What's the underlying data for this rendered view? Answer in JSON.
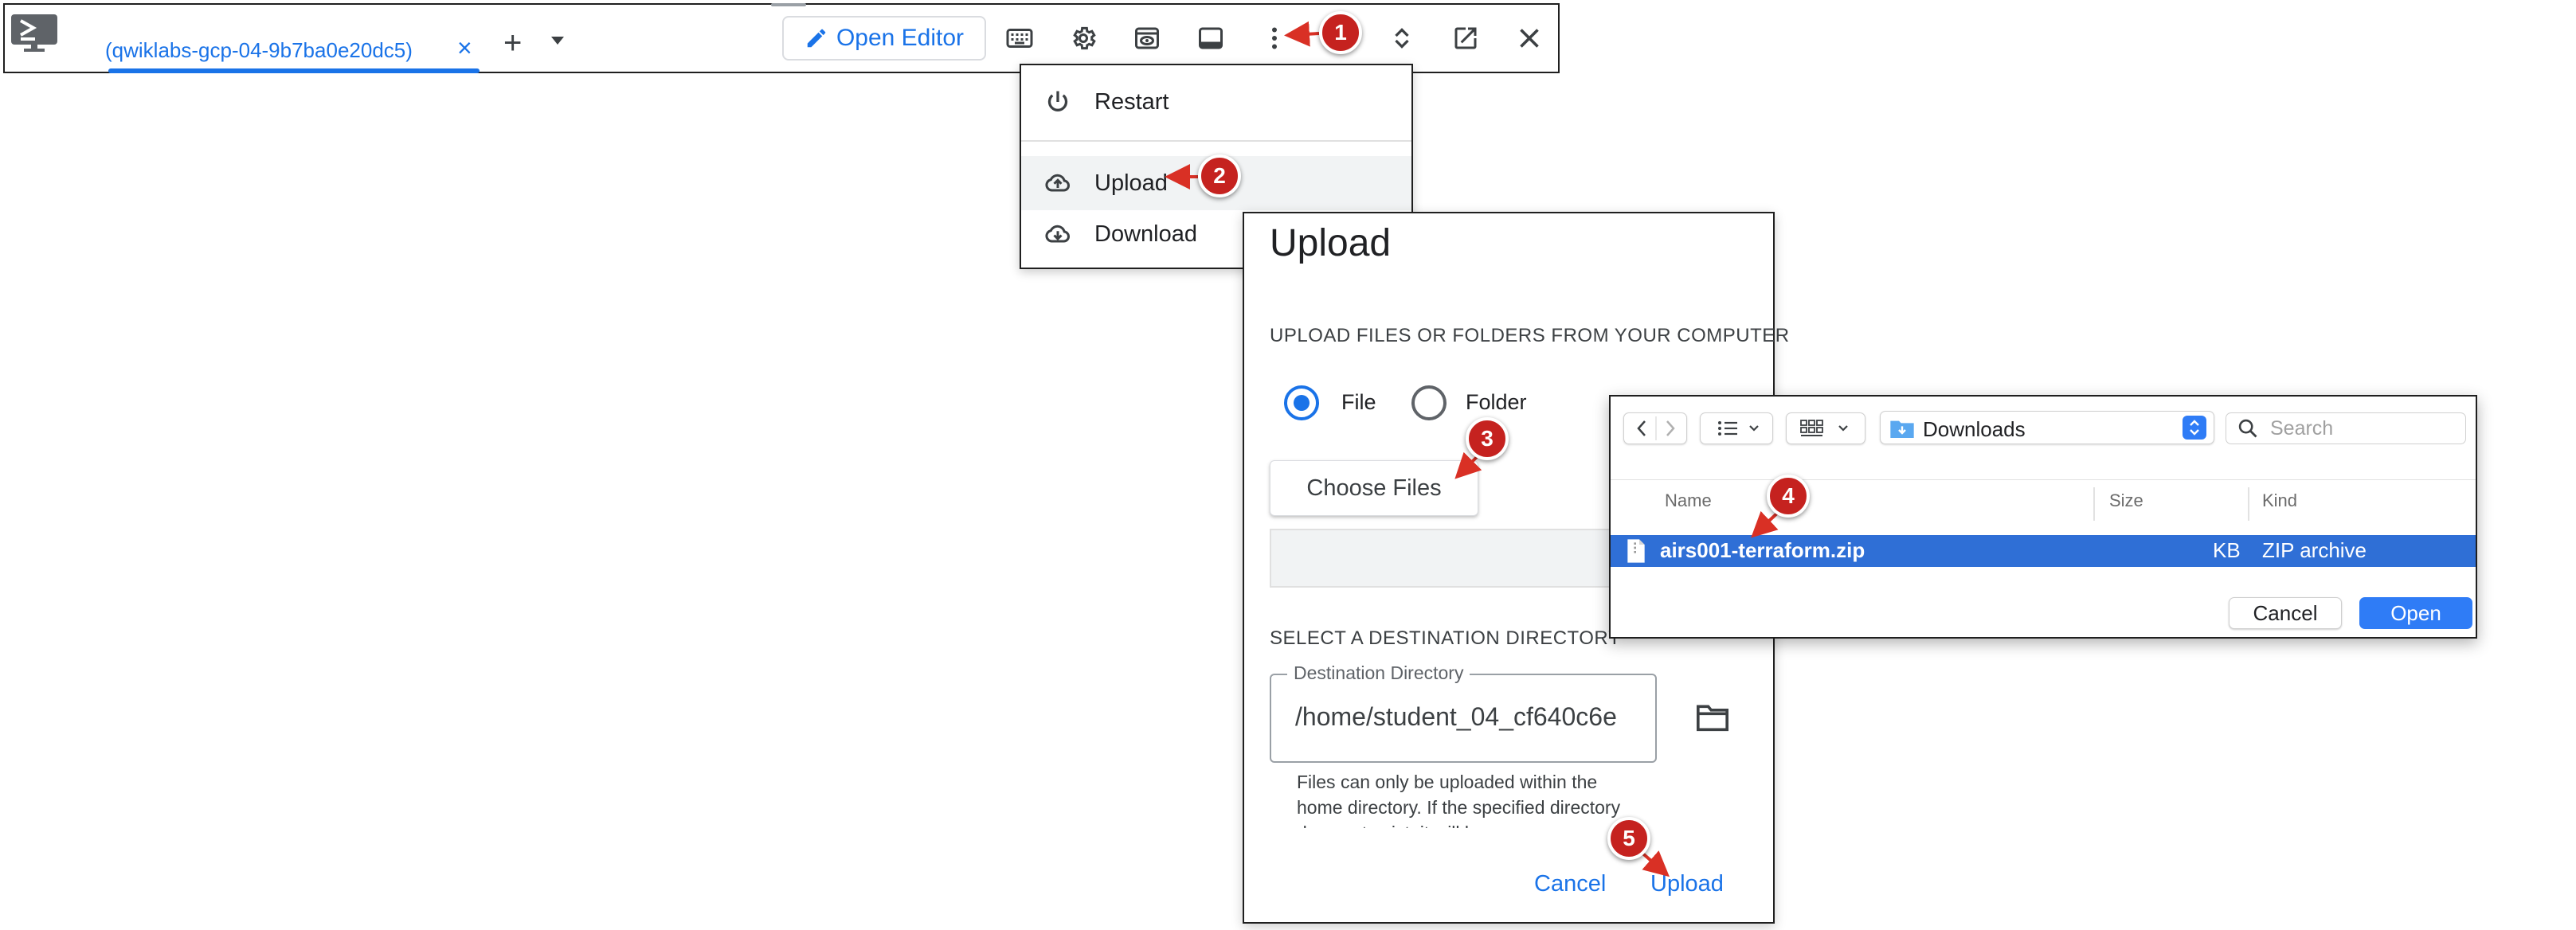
{
  "toolbar": {
    "tab_label": "(qwiklabs-gcp-04-9b7ba0e20dc5)",
    "tab_close": "×",
    "add_tab": "+",
    "open_editor_label": "Open Editor",
    "close_symbol": "✕",
    "icons": [
      "terminal-logo-icon",
      "keyboard-icon",
      "gear-icon",
      "web-preview-icon",
      "panel-icon",
      "more-vert-icon",
      "expand-icon",
      "open-new-window-icon",
      "close-icon"
    ]
  },
  "menu": {
    "items": [
      {
        "label": "Restart",
        "icon": "power-icon"
      },
      {
        "label": "Upload",
        "icon": "cloud-upload-icon"
      },
      {
        "label": "Download",
        "icon": "cloud-download-icon"
      }
    ]
  },
  "upload_dialog": {
    "title": "Upload",
    "source_heading": "UPLOAD FILES OR FOLDERS FROM YOUR COMPUTER",
    "radio_file": "File",
    "radio_folder": "Folder",
    "selected": "File",
    "choose_files": "Choose Files",
    "dest_heading": "SELECT A DESTINATION DIRECTORY",
    "dest_legend": "Destination Directory",
    "dest_value": "/home/student_04_cf640c6e",
    "hint": "Files can only be uploaded within the home directory. If the specified directory does not exist, it will be",
    "cancel": "Cancel",
    "upload": "Upload"
  },
  "file_picker": {
    "location": "Downloads",
    "search_placeholder": "Search",
    "columns": [
      "Name",
      "Size",
      "Kind"
    ],
    "rows": [
      {
        "name": "airs001-terraform.zip",
        "size": "KB",
        "kind": "ZIP archive",
        "selected": true
      }
    ],
    "cancel": "Cancel",
    "open": "Open"
  },
  "callouts": [
    "1",
    "2",
    "3",
    "4",
    "5"
  ],
  "colors": {
    "accent": "#1a73e8",
    "callout": "#c5221f",
    "selection": "#2f6fd6",
    "mac_blue": "#2f7cf6"
  }
}
